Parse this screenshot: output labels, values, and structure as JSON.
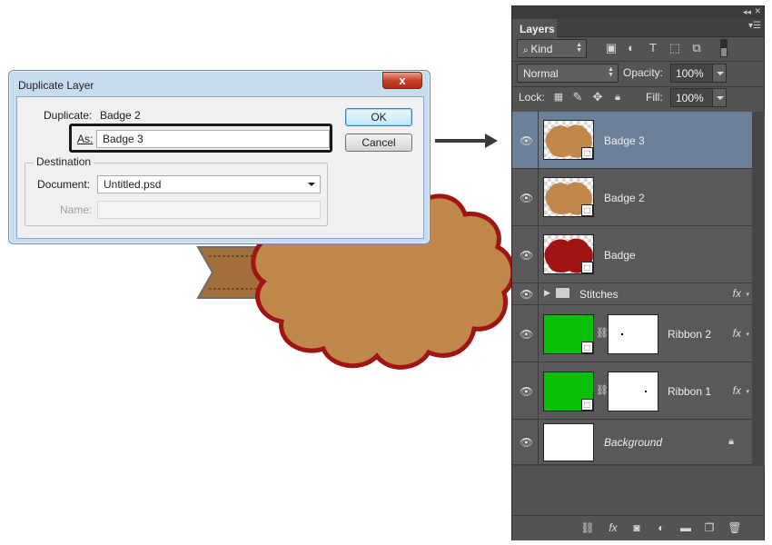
{
  "dialog": {
    "title": "Duplicate Layer",
    "close_label": "x",
    "duplicate_label": "Duplicate:",
    "duplicate_value": "Badge 2",
    "as_label": "As:",
    "as_value": "Badge 3",
    "ok_label": "OK",
    "cancel_label": "Cancel",
    "destination_label": "Destination",
    "document_label": "Document:",
    "document_value": "Untitled.psd",
    "name_label": "Name:",
    "name_value": ""
  },
  "panel": {
    "tab_label": "Layers",
    "filter_label": "Kind",
    "blend_mode": "Normal",
    "opacity_label": "Opacity:",
    "opacity_value": "100%",
    "lock_label": "Lock:",
    "fill_label": "Fill:",
    "fill_value": "100%",
    "layers": [
      {
        "name": "Badge 3",
        "selected": true
      },
      {
        "name": "Badge 2",
        "selected": false
      },
      {
        "name": "Badge",
        "selected": false
      },
      {
        "name": "Stitches",
        "group": true
      },
      {
        "name": "Ribbon 2",
        "fx": "fx"
      },
      {
        "name": "Ribbon 1",
        "fx": "fx"
      },
      {
        "name": "Background",
        "locked": true
      }
    ],
    "group_fx": "fx"
  },
  "colors": {
    "badge_fill": "#c0864a",
    "badge_border": "#a01414",
    "ribbon_fill": "#a26f3d",
    "thumb_green": "#08c008",
    "selected_row": "#6c8099"
  }
}
